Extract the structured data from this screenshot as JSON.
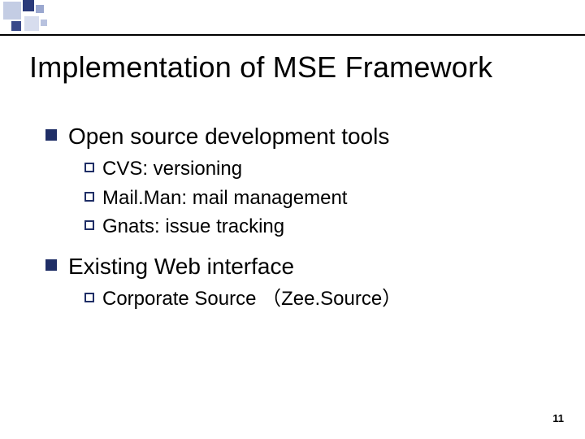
{
  "title": "Implementation of MSE Framework",
  "sections": [
    {
      "heading": "Open source development tools",
      "items": [
        "CVS: versioning",
        "Mail.Man: mail management",
        "Gnats: issue tracking"
      ]
    },
    {
      "heading": "Existing Web interface",
      "items": [
        "Corporate  Source （Zee.Source）"
      ]
    }
  ],
  "page_number": "11"
}
